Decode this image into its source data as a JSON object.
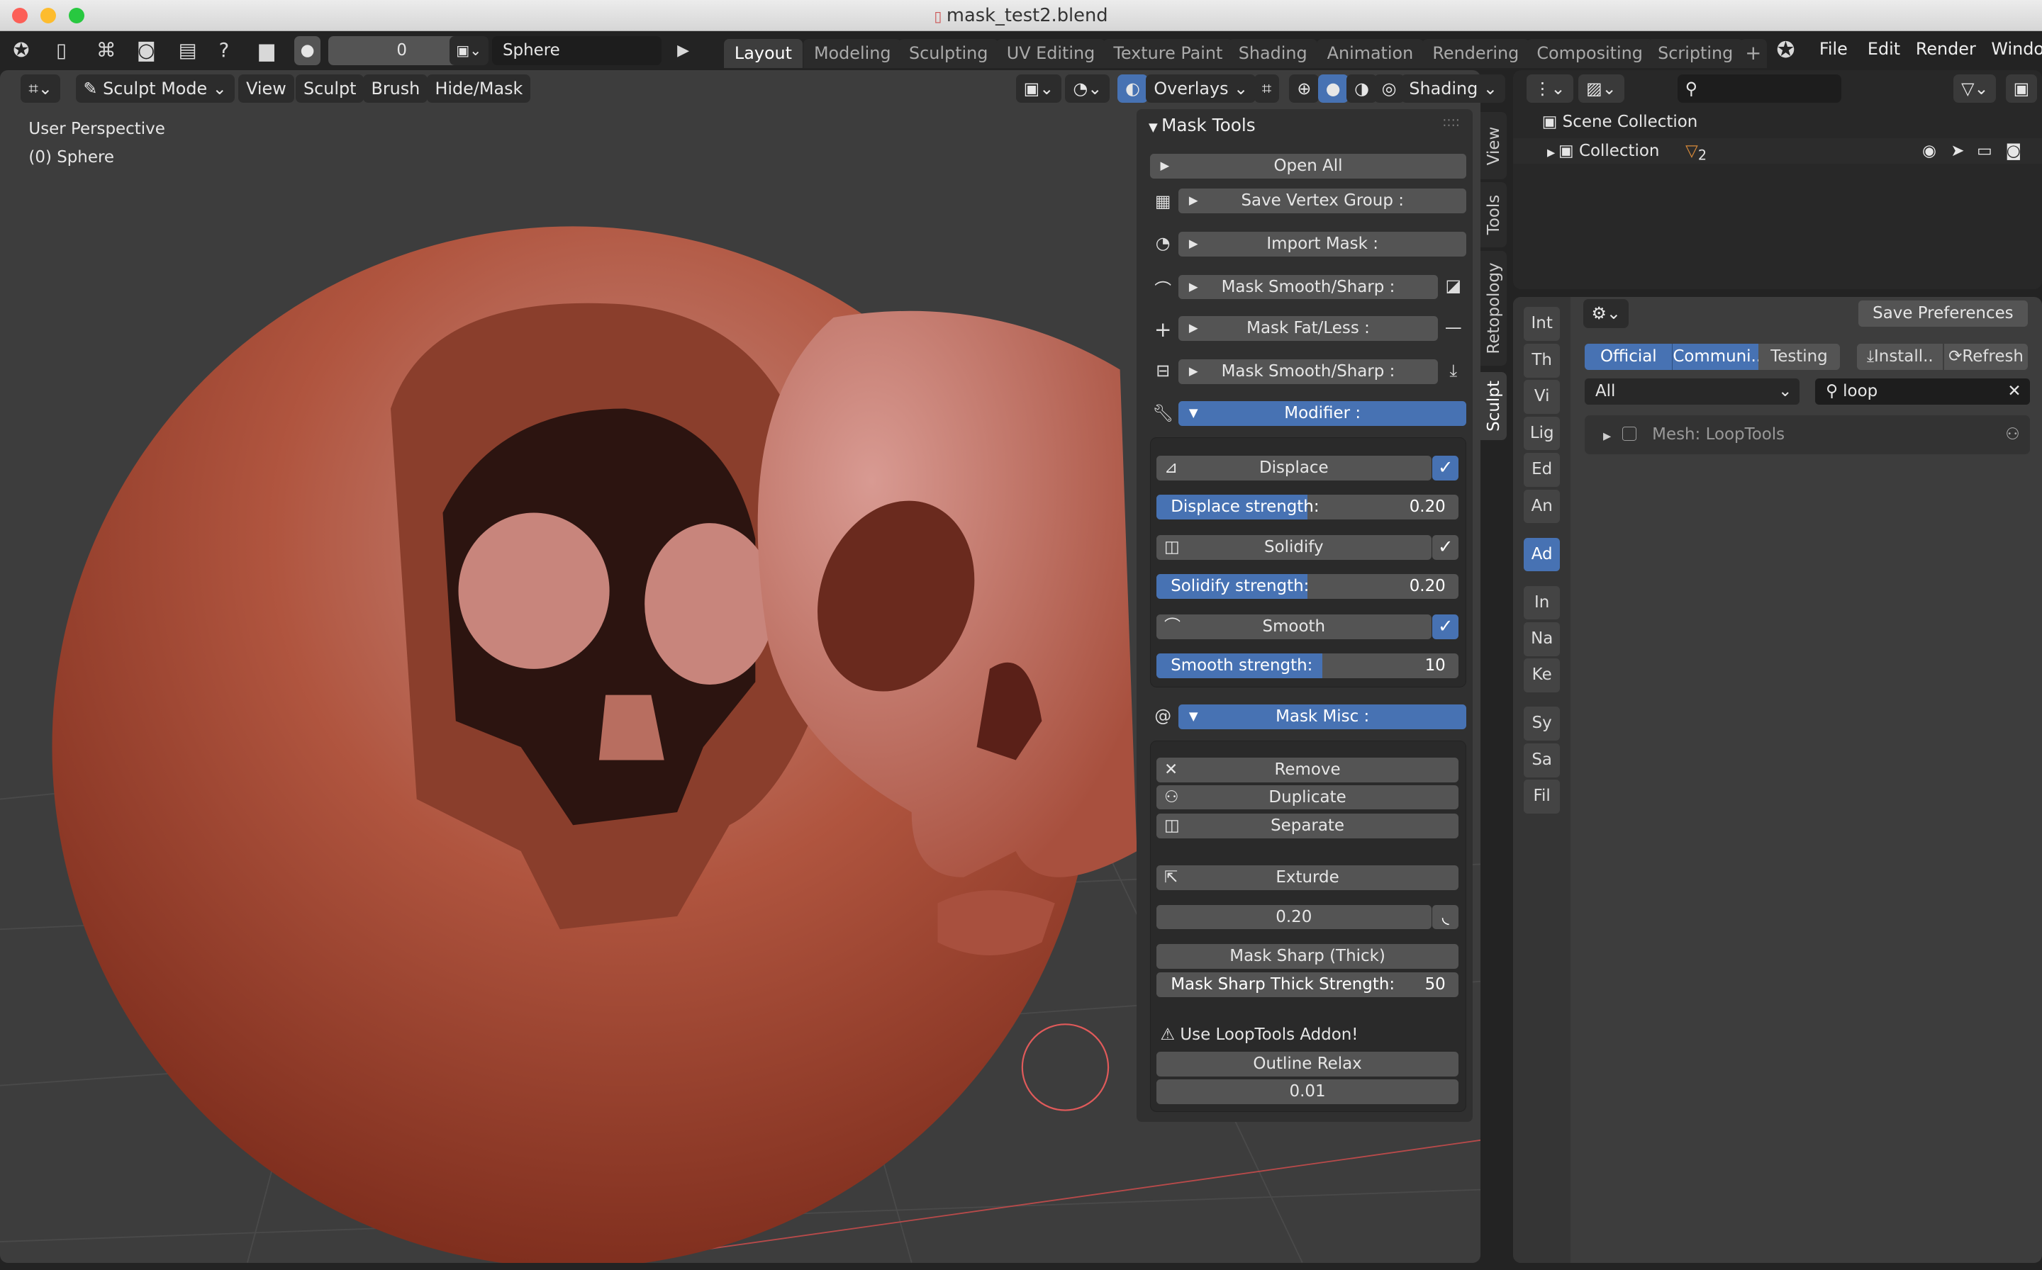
{
  "window": {
    "title": "mask_test2.blend",
    "file_icon": "blend-file-icon"
  },
  "topbar": {
    "frame_value": "0",
    "object_name": "Sphere",
    "workspace_tabs": [
      "Layout",
      "Modeling",
      "Sculpting",
      "UV Editing",
      "Texture Paint",
      "Shading",
      "Animation",
      "Rendering",
      "Compositing",
      "Scripting"
    ],
    "active_tab": "Layout",
    "add_tab": "+",
    "menus": [
      "File",
      "Edit",
      "Render",
      "Window"
    ]
  },
  "viewport": {
    "mode": "Sculpt Mode",
    "menus": [
      "View",
      "Sculpt",
      "Brush",
      "Hide/Mask"
    ],
    "overlays_label": "Overlays",
    "shading_label": "Shading",
    "info_line1": "User Perspective",
    "info_line2": "(0) Sphere",
    "colors": {
      "sphere": "#a8432e",
      "background": "#3d3d3d",
      "brush_circle": "#e05a5a"
    }
  },
  "npanel": {
    "title": "Mask Tools",
    "open_all": "Open All",
    "save_vertex_group": "Save Vertex Group :",
    "import_mask": "Import Mask :",
    "mask_smooth_sharp_1": "Mask Smooth/Sharp :",
    "mask_fat_less": "Mask Fat/Less :",
    "mask_smooth_sharp_2": "Mask Smooth/Sharp :",
    "modifier": "Modifier :",
    "displace": "Displace",
    "displace_checked": true,
    "displace_strength_label": "Displace strength:",
    "displace_strength_value": "0.20",
    "displace_strength_fill": 0.5,
    "solidify": "Solidify",
    "solidify_checked": true,
    "solidify_strength_label": "Solidify strength:",
    "solidify_strength_value": "0.20",
    "solidify_strength_fill": 0.5,
    "smooth": "Smooth",
    "smooth_checked": true,
    "smooth_strength_label": "Smooth strength:",
    "smooth_strength_value": "10",
    "smooth_strength_fill": 0.55,
    "mask_misc": "Mask Misc :",
    "remove": "Remove",
    "duplicate": "Duplicate",
    "separate": "Separate",
    "exturde": "Exturde",
    "extrude_value": "0.20",
    "mask_sharp_thick": "Mask Sharp (Thick)",
    "mask_sharp_thick_strength_label": "Mask Sharp Thick Strength:",
    "mask_sharp_thick_strength_value": "50",
    "warning": "Use LoopTools Addon!",
    "outline_relax": "Outline Relax",
    "outline_relax_value": "0.01",
    "side_tabs": [
      "View",
      "Tools",
      "Retopology",
      "Sculpt"
    ]
  },
  "outliner": {
    "scene_collection": "Scene Collection",
    "collection": "Collection",
    "object_count": "2"
  },
  "preferences": {
    "save_button": "Save Preferences",
    "tabs": [
      "Int",
      "Th",
      "Vi",
      "Lig",
      "Ed",
      "An",
      "Ad",
      "In",
      "Na",
      "Ke",
      "Sy",
      "Sa",
      "Fil"
    ],
    "active_tab": "Ad",
    "filter_tabs": [
      "Official",
      "Communi..",
      "Testing"
    ],
    "install": "Install..",
    "refresh": "Refresh",
    "category": "All",
    "search_value": "loop",
    "addon_name": "Mesh: LoopTools"
  }
}
